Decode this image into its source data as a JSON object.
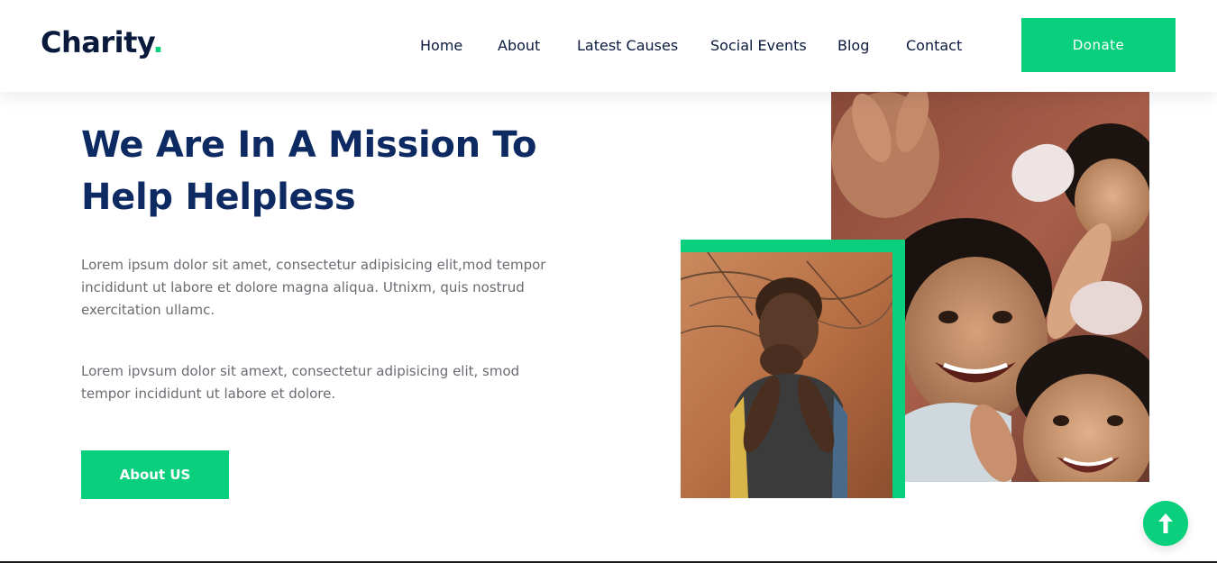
{
  "brand": {
    "name": "Charity",
    "dot": ".",
    "accent_color": "#0acf7c",
    "text_color": "#0a1a3c"
  },
  "nav": {
    "items": [
      {
        "label": "Home"
      },
      {
        "label": "About"
      },
      {
        "label": "Latest Causes"
      },
      {
        "label": "Social Events"
      },
      {
        "label": "Blog"
      },
      {
        "label": "Contact"
      }
    ],
    "donate_label": "Donate"
  },
  "hero": {
    "title": "We Are In A Mission To Help Helpless",
    "paragraph_1": "Lorem ipsum dolor sit amet, consectetur adipisicing elit,mod tempor incididunt ut labore et dolore magna aliqua. Utnixm, quis nostrud exercitation ullamc.",
    "paragraph_2": "Lorem ipvsum dolor sit amext, consectetur adipisicing elit, smod tempor incididunt ut labore et dolore.",
    "button_label": "About US",
    "title_color": "#0e2a62"
  },
  "media": {
    "large_photo": "smiling-children-photo",
    "small_photo": "child-portrait-photo"
  },
  "scroll_top_icon": "arrow-up-icon"
}
